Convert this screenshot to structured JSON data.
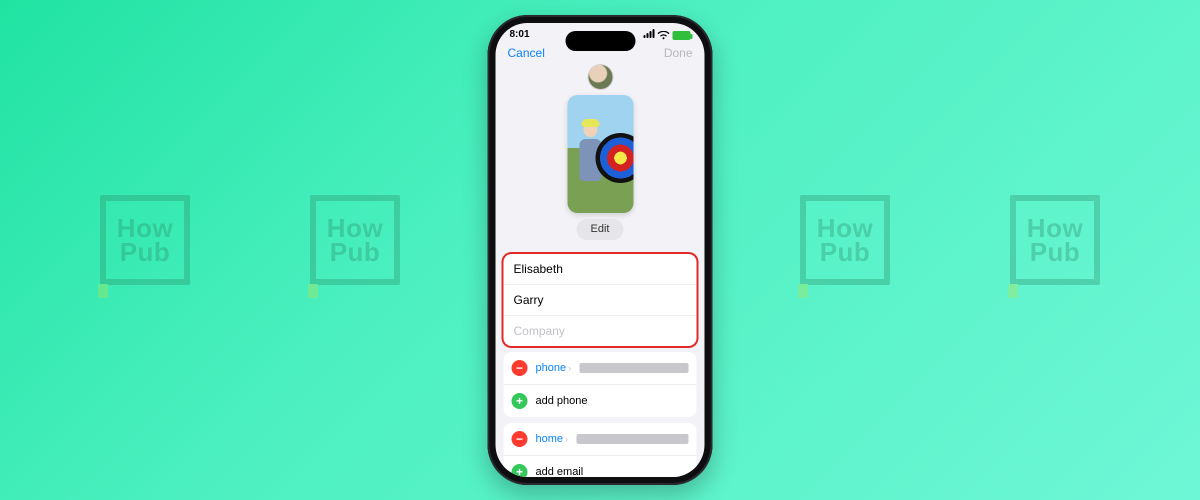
{
  "watermark": {
    "line1": "How",
    "line2": "Pub"
  },
  "status": {
    "time": "8:01",
    "battery_icon": "battery-full-icon"
  },
  "nav": {
    "cancel": "Cancel",
    "done": "Done"
  },
  "hero": {
    "edit": "Edit"
  },
  "name_card": {
    "first": "Elisabeth",
    "last": "Garry",
    "company_placeholder": "Company"
  },
  "phones": {
    "existing": {
      "label": "phone",
      "value_redacted": true
    },
    "add": {
      "label": "add phone"
    }
  },
  "emails": {
    "existing": {
      "label": "home",
      "value_redacted": true
    },
    "add": {
      "label": "add email"
    }
  }
}
